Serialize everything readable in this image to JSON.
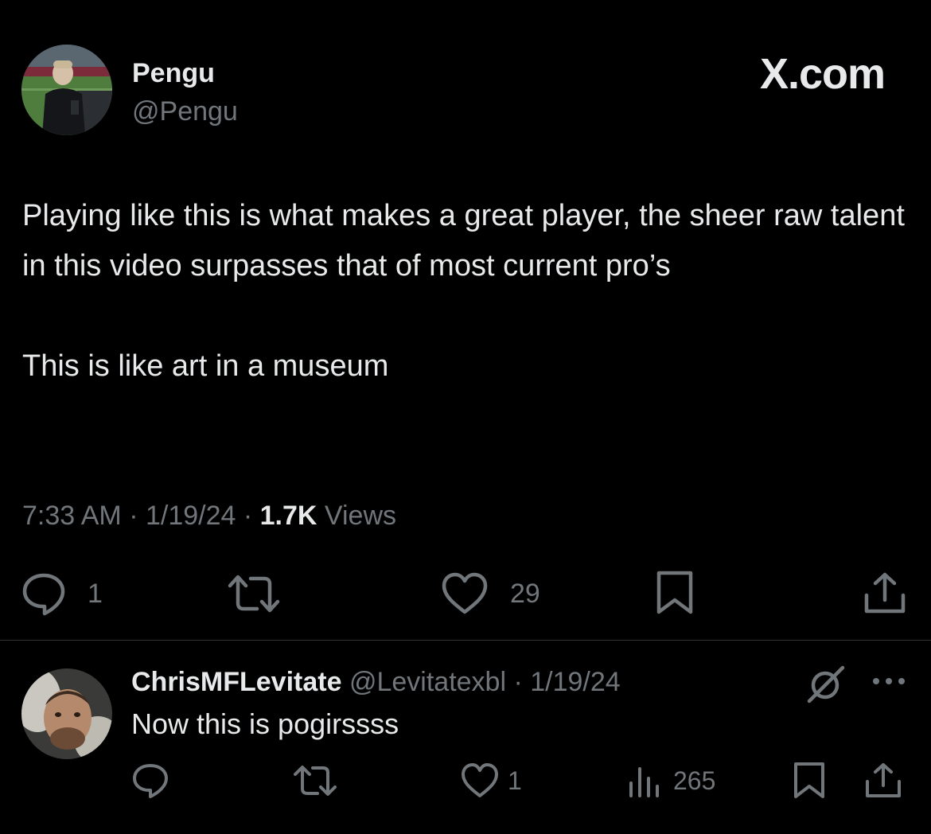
{
  "tweet": {
    "author": {
      "name": "Pengu",
      "handle": "@Pengu"
    },
    "brand": "X.com",
    "text": {
      "paragraph1": "Playing like this is what makes a great player, the sheer raw talent in this video surpasses that of most current pro’s",
      "paragraph2": "This is like art in a museum"
    },
    "meta": {
      "time": "7:33 AM",
      "separator": " · ",
      "date": "1/19/24",
      "views_count": "1.7K",
      "views_label": " Views"
    },
    "actions": {
      "reply_count": "1",
      "retweet_count": "",
      "like_count": "29"
    },
    "icons": {
      "reply": "reply-icon",
      "retweet": "retweet-icon",
      "like": "heart-icon",
      "bookmark": "bookmark-icon",
      "share": "share-icon"
    }
  },
  "reply": {
    "name": "ChrisMFLevitate",
    "handle": " @Levitatexbl",
    "separator": " · ",
    "date": "1/19/24",
    "text": "Now this is pogirssss",
    "actions": {
      "reply_count": "",
      "retweet_count": "",
      "like_count": "1",
      "views_count": "265"
    },
    "icons": {
      "grok": "grok-icon",
      "more": "more-icon",
      "views": "views-icon"
    }
  },
  "colors": {
    "background": "#000000",
    "text_primary": "#e7e9ea",
    "text_secondary": "#71767b",
    "divider": "#2f3336"
  }
}
